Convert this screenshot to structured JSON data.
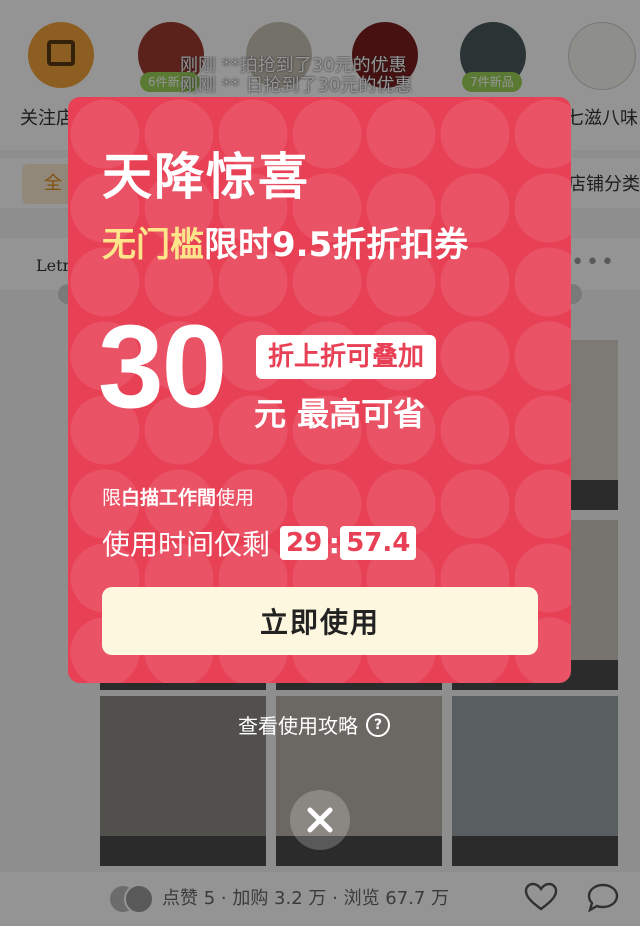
{
  "background": {
    "stories": [
      {
        "badge": "",
        "label": "关注店"
      },
      {
        "badge": "6件新品",
        "label": ""
      },
      {
        "badge": "",
        "label": ""
      },
      {
        "badge": "",
        "label": ""
      },
      {
        "badge": "7件新品",
        "label": ""
      },
      {
        "badge": "",
        "label": "七滋八味"
      }
    ],
    "scroll_news": [
      "刚刚  **拍抢到了30元的优惠",
      "刚刚 ** 日抢到了30元的优惠"
    ],
    "tab_left": "全",
    "tab_right": "店铺分类",
    "brand_name": "Letr",
    "brand_more": "•••",
    "stats": "点赞 5 · 加购 3.2 万 · 浏览 67.7 万"
  },
  "coupon": {
    "title": "天降惊喜",
    "subtitle_highlight": "无门槛",
    "subtitle_rest": "限时9.5折折扣券",
    "amount": "30",
    "stack_tag": "折上折可叠加",
    "save_text": "元 最高可省",
    "limit_prefix": "限",
    "limit_shop": "白描工作間",
    "limit_suffix": "使用",
    "timer_label": "使用时间仅剩",
    "timer_minutes": "29",
    "timer_seconds": "57.4",
    "use_button": "立即使用"
  },
  "guide_text": "查看使用攻略",
  "colors": {
    "coupon_red": "#e84055",
    "highlight_yellow": "#ffe58a",
    "button_cream": "#fdf7df"
  }
}
